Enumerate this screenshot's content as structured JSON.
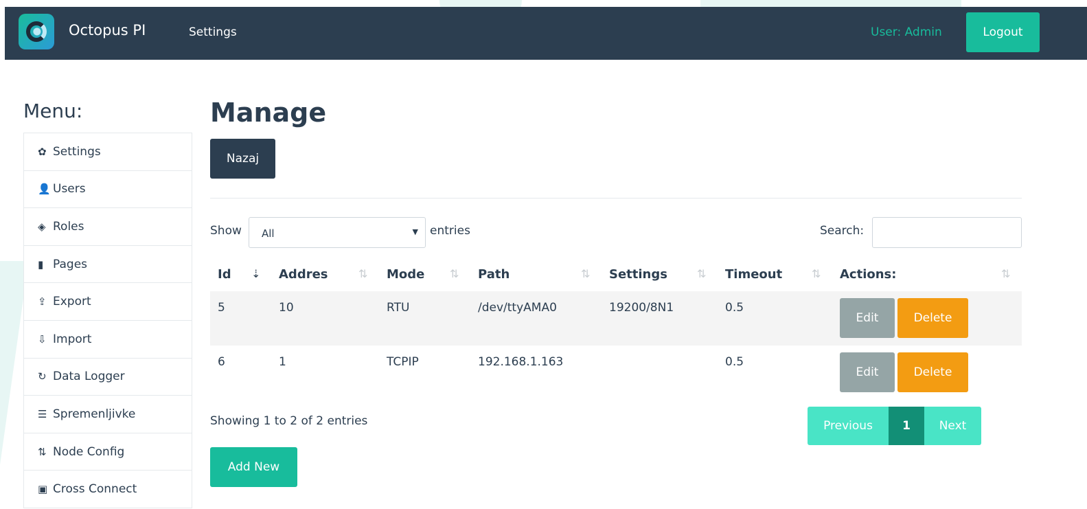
{
  "navbar": {
    "brand": "Octopus PI",
    "link_settings": "Settings",
    "user_label": "User: Admin",
    "logout_label": "Logout"
  },
  "menu": {
    "title": "Menu:",
    "items": [
      {
        "label": "Settings",
        "icon": "gear-icon",
        "glyph": "✿"
      },
      {
        "label": "Users",
        "icon": "user-icon",
        "glyph": "👤"
      },
      {
        "label": "Roles",
        "icon": "eye-slash-icon",
        "glyph": "◈"
      },
      {
        "label": "Pages",
        "icon": "pages-icon",
        "glyph": "▮"
      },
      {
        "label": "Export",
        "icon": "export-icon",
        "glyph": "⇪"
      },
      {
        "label": "Import",
        "icon": "import-icon",
        "glyph": "⇩"
      },
      {
        "label": "Data Logger",
        "icon": "refresh-icon",
        "glyph": "↻"
      },
      {
        "label": "Spremenljivke",
        "icon": "list-icon",
        "glyph": "☰"
      },
      {
        "label": "Node Config",
        "icon": "sort-icon",
        "glyph": "⇅"
      },
      {
        "label": "Cross Connect",
        "icon": "cc-icon",
        "glyph": "▣"
      }
    ]
  },
  "main": {
    "title": "Manage",
    "back_label": "Nazaj",
    "show_label": "Show",
    "show_value": "All",
    "entries_label": "entries",
    "search_label": "Search:",
    "search_value": "",
    "columns": [
      "Id",
      "Addres",
      "Mode",
      "Path",
      "Settings",
      "Timeout",
      "Actions:"
    ],
    "rows": [
      {
        "id": "5",
        "addres": "10",
        "mode": "RTU",
        "path": "/dev/ttyAMA0",
        "settings": "19200/8N1",
        "timeout": "0.5"
      },
      {
        "id": "6",
        "addres": "1",
        "mode": "TCPIP",
        "path": "192.168.1.163",
        "settings": "",
        "timeout": "0.5"
      }
    ],
    "edit_label": "Edit",
    "delete_label": "Delete",
    "showing_text": "Showing 1 to 2 of 2 entries",
    "pager": {
      "previous": "Previous",
      "current": "1",
      "next": "Next"
    },
    "add_new_label": "Add New"
  },
  "colors": {
    "navbar": "#2c3e50",
    "accent": "#18bc9c",
    "edit": "#95a5a6",
    "delete": "#f39c12"
  }
}
